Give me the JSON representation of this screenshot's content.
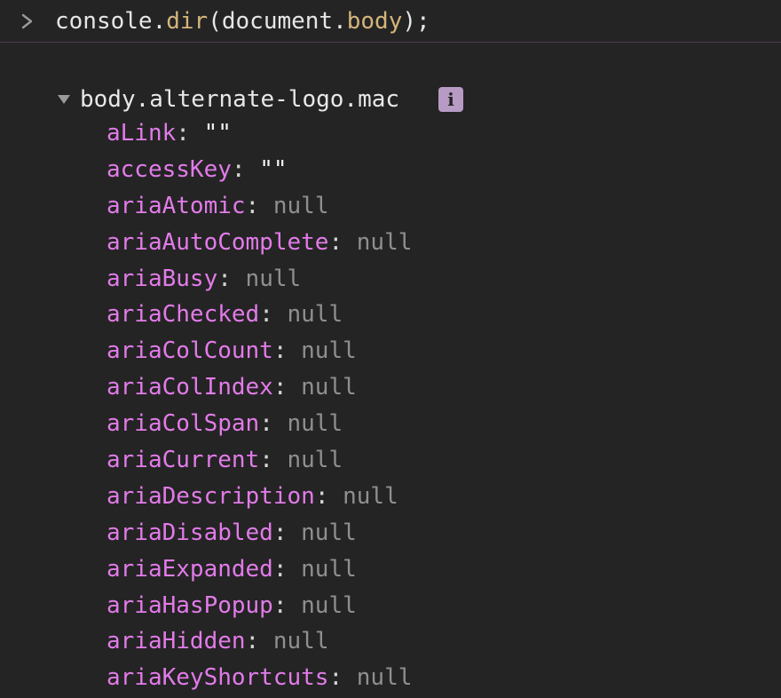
{
  "console": {
    "prompt_icon": "chevron-right-icon",
    "command": {
      "object": "console",
      "dot1": ".",
      "method": "dir",
      "open_paren": "(",
      "arg_object": "document",
      "dot2": ".",
      "arg_prop": "body",
      "close": ");"
    }
  },
  "tree": {
    "disclosure_icon": "triangle-down-icon",
    "root_label": "body.alternate-logo.mac",
    "info_icon": "info-icon",
    "info_glyph": "i",
    "properties": [
      {
        "name": "aLink",
        "value": "\"\"",
        "type": "string"
      },
      {
        "name": "accessKey",
        "value": "\"\"",
        "type": "string"
      },
      {
        "name": "ariaAtomic",
        "value": "null",
        "type": "null"
      },
      {
        "name": "ariaAutoComplete",
        "value": "null",
        "type": "null"
      },
      {
        "name": "ariaBusy",
        "value": "null",
        "type": "null"
      },
      {
        "name": "ariaChecked",
        "value": "null",
        "type": "null"
      },
      {
        "name": "ariaColCount",
        "value": "null",
        "type": "null"
      },
      {
        "name": "ariaColIndex",
        "value": "null",
        "type": "null"
      },
      {
        "name": "ariaColSpan",
        "value": "null",
        "type": "null"
      },
      {
        "name": "ariaCurrent",
        "value": "null",
        "type": "null"
      },
      {
        "name": "ariaDescription",
        "value": "null",
        "type": "null"
      },
      {
        "name": "ariaDisabled",
        "value": "null",
        "type": "null"
      },
      {
        "name": "ariaExpanded",
        "value": "null",
        "type": "null"
      },
      {
        "name": "ariaHasPopup",
        "value": "null",
        "type": "null"
      },
      {
        "name": "ariaHidden",
        "value": "null",
        "type": "null"
      },
      {
        "name": "ariaKeyShortcuts",
        "value": "null",
        "type": "null"
      }
    ]
  },
  "colors": {
    "background": "#242424",
    "property_name": "#e27be9",
    "null_value": "#8f8f8f",
    "method": "#d4b57a",
    "info_badge": "#b79bc4",
    "divider": "#4a3d4d"
  }
}
